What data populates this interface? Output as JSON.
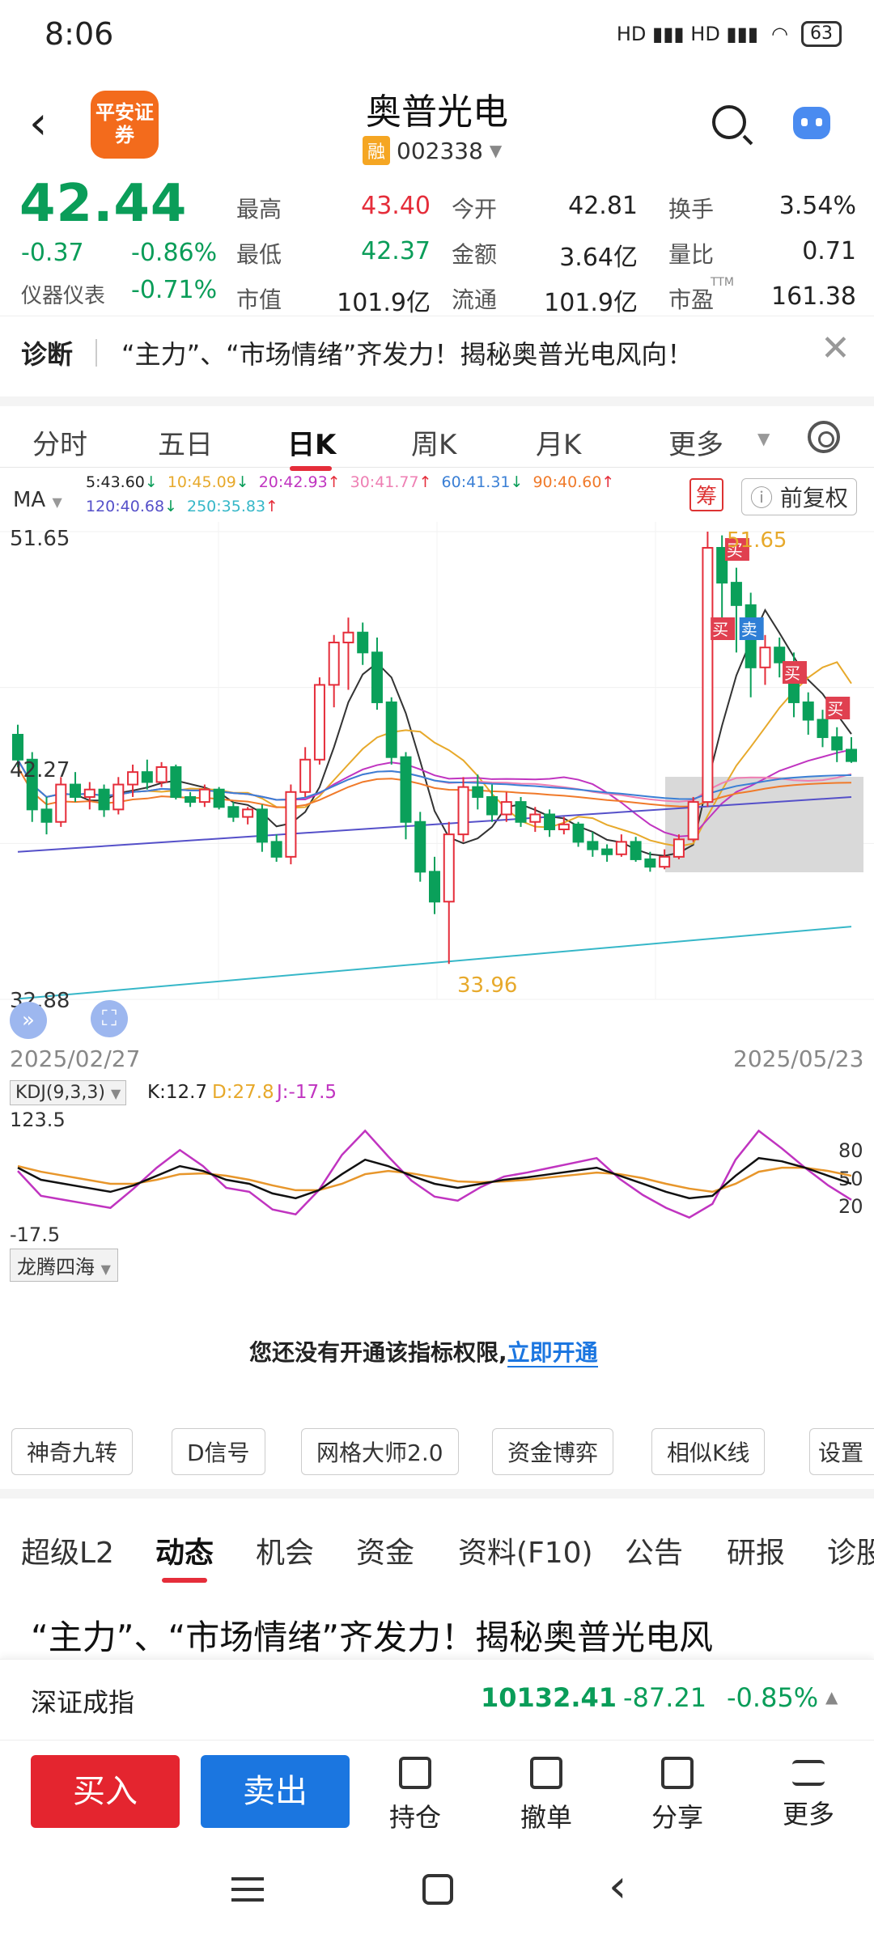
{
  "status_bar": {
    "time": "8:06",
    "network": "HD ▮▮▮ HD ▮▮▮",
    "battery": "63"
  },
  "header": {
    "logo_text": "平安证券",
    "title": "奥普光电",
    "badge": "融",
    "code": "002338"
  },
  "quote": {
    "price": "42.44",
    "change": "-0.37",
    "change_pct": "-0.86%",
    "sector": "仪器仪表",
    "sector_pct": "-0.71%",
    "rows": [
      [
        {
          "label": "最高",
          "value": "43.40",
          "color": "r"
        },
        {
          "label": "今开",
          "value": "42.81",
          "color": "k"
        },
        {
          "label": "换手",
          "value": "3.54%",
          "color": "k"
        }
      ],
      [
        {
          "label": "最低",
          "value": "42.37",
          "color": "g"
        },
        {
          "label": "金额",
          "value": "3.64亿",
          "color": "k"
        },
        {
          "label": "量比",
          "value": "0.71",
          "color": "k"
        }
      ],
      [
        {
          "label": "市值",
          "value": "101.9亿",
          "color": "k"
        },
        {
          "label": "流通",
          "value": "101.9亿",
          "color": "k"
        },
        {
          "label": "市盈",
          "value": "161.38",
          "color": "k",
          "sup": "TTM"
        }
      ]
    ]
  },
  "news": {
    "tag": "诊断",
    "text": "“主力”、“市场情绪”齐发力！揭秘奥普光电风向！"
  },
  "ktabs": [
    "分时",
    "五日",
    "日K",
    "周K",
    "月K",
    "更多"
  ],
  "ma": {
    "label": "MA",
    "items": [
      {
        "text": "5:43.60",
        "arrow": "↓",
        "color": "#222"
      },
      {
        "text": "10:45.09",
        "arrow": "↓",
        "color": "#e7a92b"
      },
      {
        "text": "20:42.93",
        "arrow": "↑",
        "color": "#c034c0"
      },
      {
        "text": "30:41.77",
        "arrow": "↑",
        "color": "#ee7fb3"
      },
      {
        "text": "60:41.31",
        "arrow": "↓",
        "color": "#3a7fd5"
      },
      {
        "text": "90:40.60",
        "arrow": "↑",
        "color": "#f07a2a"
      }
    ],
    "items2": [
      {
        "text": "120:40.68",
        "arrow": "↓",
        "color": "#5550c9"
      },
      {
        "text": "250:35.83",
        "arrow": "↑",
        "color": "#36b7c8"
      }
    ],
    "chip": "筹",
    "adjust": "前复权"
  },
  "kchart": {
    "y_max": "51.65",
    "y_mid": "42.27",
    "y_min": "32.88",
    "date_start": "2025/02/27",
    "date_end": "2025/05/23",
    "high_mark": "51.65",
    "low_mark": "33.96",
    "buy": "买",
    "sell": "卖"
  },
  "kdj": {
    "label": "KDJ(9,3,3)",
    "k": "K:12.7",
    "d": "D:27.8",
    "j": "J:-17.5",
    "top": "123.5",
    "bottom": "-17.5",
    "levels": [
      "80",
      "50",
      "20"
    ]
  },
  "ltsh": {
    "label": "龙腾四海",
    "msg": "您还没有开通该指标权限,",
    "link": "立即开通"
  },
  "tools": [
    "神奇九转",
    "D信号",
    "网格大师2.0",
    "资金博弈",
    "相似K线",
    "设置"
  ],
  "btabs": [
    "超级L2",
    "动态",
    "机会",
    "资金",
    "资料(F10)",
    "公告",
    "研报",
    "诊股"
  ],
  "article": {
    "title": "“主力”、“市场情绪”齐发力！揭秘奥普光电风"
  },
  "index": {
    "name": "深证成指",
    "value": "10132.41",
    "change": "-87.21",
    "pct": "-0.85%"
  },
  "actions": {
    "buy": "买入",
    "sell": "卖出",
    "items": [
      "持仓",
      "撤单",
      "分享",
      "更多"
    ]
  },
  "chart_data": {
    "type": "candlestick",
    "y_range": [
      32.88,
      51.65
    ],
    "x_range": [
      "2025/02/27",
      "2025/05/23"
    ],
    "ohlc": [
      [
        43.5,
        43.9,
        42.2,
        42.5
      ],
      [
        42.5,
        42.8,
        40.0,
        40.5
      ],
      [
        40.5,
        41.0,
        39.5,
        40.0
      ],
      [
        40.0,
        41.8,
        39.8,
        41.5
      ],
      [
        41.5,
        42.0,
        40.8,
        41.0
      ],
      [
        41.0,
        41.6,
        40.5,
        41.3
      ],
      [
        41.3,
        41.5,
        40.2,
        40.5
      ],
      [
        40.5,
        41.8,
        40.3,
        41.5
      ],
      [
        41.5,
        42.3,
        41.0,
        42.0
      ],
      [
        42.0,
        42.5,
        41.3,
        41.6
      ],
      [
        41.6,
        42.4,
        41.4,
        42.2
      ],
      [
        42.2,
        42.3,
        40.9,
        41.0
      ],
      [
        41.0,
        41.2,
        40.6,
        40.8
      ],
      [
        40.8,
        41.5,
        40.6,
        41.3
      ],
      [
        41.3,
        41.4,
        40.5,
        40.6
      ],
      [
        40.6,
        40.8,
        40.0,
        40.2
      ],
      [
        40.2,
        40.6,
        39.9,
        40.5
      ],
      [
        40.5,
        40.7,
        38.8,
        39.2
      ],
      [
        39.2,
        39.5,
        38.4,
        38.6
      ],
      [
        38.6,
        41.5,
        38.3,
        41.2
      ],
      [
        41.2,
        43.0,
        41.0,
        42.5
      ],
      [
        42.5,
        45.8,
        42.3,
        45.5
      ],
      [
        45.5,
        47.5,
        44.6,
        47.2
      ],
      [
        47.2,
        48.2,
        45.3,
        47.6
      ],
      [
        47.6,
        48.0,
        46.3,
        46.8
      ],
      [
        46.8,
        47.4,
        44.5,
        44.8
      ],
      [
        44.8,
        45.0,
        42.3,
        42.6
      ],
      [
        42.6,
        42.8,
        39.3,
        40.0
      ],
      [
        40.0,
        40.4,
        37.6,
        38.0
      ],
      [
        38.0,
        38.6,
        36.3,
        36.8
      ],
      [
        36.8,
        40.0,
        34.3,
        39.5
      ],
      [
        39.5,
        41.8,
        39.2,
        41.4
      ],
      [
        41.4,
        41.9,
        40.5,
        41.0
      ],
      [
        41.0,
        41.5,
        40.0,
        40.3
      ],
      [
        40.3,
        41.2,
        40.0,
        40.8
      ],
      [
        40.8,
        41.0,
        39.8,
        40.0
      ],
      [
        40.0,
        40.6,
        39.6,
        40.3
      ],
      [
        40.3,
        40.5,
        39.4,
        39.7
      ],
      [
        39.7,
        40.2,
        39.5,
        39.9
      ],
      [
        39.9,
        40.0,
        39.0,
        39.2
      ],
      [
        39.2,
        39.6,
        38.6,
        38.9
      ],
      [
        38.9,
        39.1,
        38.4,
        38.7
      ],
      [
        38.7,
        39.5,
        38.6,
        39.2
      ],
      [
        39.2,
        39.4,
        38.4,
        38.5
      ],
      [
        38.5,
        38.8,
        38.0,
        38.2
      ],
      [
        38.2,
        38.9,
        38.1,
        38.6
      ],
      [
        38.6,
        39.5,
        38.5,
        39.3
      ],
      [
        39.3,
        41.0,
        39.2,
        40.8
      ],
      [
        40.8,
        51.65,
        40.6,
        51.0
      ],
      [
        51.0,
        51.5,
        47.5,
        49.6
      ],
      [
        49.6,
        50.2,
        46.8,
        48.7
      ],
      [
        48.7,
        49.2,
        45.0,
        46.2
      ],
      [
        46.2,
        47.5,
        45.5,
        47.0
      ],
      [
        47.0,
        47.4,
        45.8,
        46.4
      ],
      [
        46.4,
        46.8,
        44.2,
        44.8
      ],
      [
        44.8,
        45.2,
        43.5,
        44.1
      ],
      [
        44.1,
        44.5,
        43.0,
        43.4
      ],
      [
        43.4,
        43.8,
        42.4,
        42.9
      ],
      [
        42.9,
        43.4,
        42.37,
        42.44
      ]
    ]
  }
}
